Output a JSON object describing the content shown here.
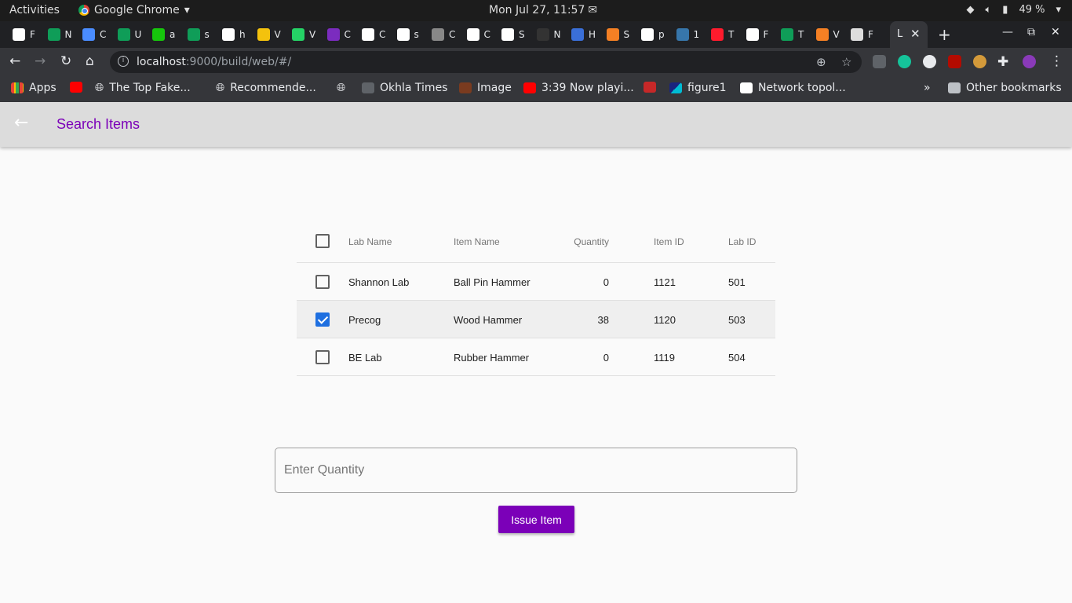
{
  "system_bar": {
    "activities": "Activities",
    "app_name": "Google Chrome",
    "clock": "Mon Jul 27, 11:57",
    "battery": "49 %"
  },
  "browser": {
    "active_tab_title": "L",
    "url_host": "localhost",
    "url_path": ":9000/build/web/#/",
    "tabs": [
      {
        "letter": "F",
        "icon": "gmail-icon",
        "color": "#ffffff"
      },
      {
        "letter": "N",
        "icon": "google-drive-icon",
        "color": "#0f9d58"
      },
      {
        "letter": "C",
        "icon": "infinity-icon",
        "color": "#4a8cff"
      },
      {
        "letter": "U",
        "icon": "sheets-icon",
        "color": "#0f9d58"
      },
      {
        "letter": "a",
        "icon": "fa-icon",
        "color": "#16c60c"
      },
      {
        "letter": "s",
        "icon": "sheets-icon",
        "color": "#0f9d58"
      },
      {
        "letter": "h",
        "icon": "google-icon",
        "color": "#ffffff"
      },
      {
        "letter": "V",
        "icon": "k-icon",
        "color": "#f4c20d"
      },
      {
        "letter": "V",
        "icon": "whatsapp-icon",
        "color": "#25d366"
      },
      {
        "letter": "C",
        "icon": "list-icon",
        "color": "#7b2cbf"
      },
      {
        "letter": "C",
        "icon": "globe-icon",
        "color": "#ffffff"
      },
      {
        "letter": "s",
        "icon": "google-icon",
        "color": "#ffffff"
      },
      {
        "letter": "C",
        "icon": "barcode-icon",
        "color": "#888888"
      },
      {
        "letter": "C",
        "icon": "image-icon",
        "color": "#ffffff"
      },
      {
        "letter": "S",
        "icon": "google-icon",
        "color": "#ffffff"
      },
      {
        "letter": "N",
        "icon": "github-icon",
        "color": "#333333"
      },
      {
        "letter": "H",
        "icon": "info-icon",
        "color": "#3a6fd8"
      },
      {
        "letter": "S",
        "icon": "stackoverflow-icon",
        "color": "#f48024"
      },
      {
        "letter": "p",
        "icon": "google-icon",
        "color": "#ffffff"
      },
      {
        "letter": "1",
        "icon": "python-icon",
        "color": "#3776ab"
      },
      {
        "letter": "T",
        "icon": "opera-icon",
        "color": "#ff1b2d"
      },
      {
        "letter": "F",
        "icon": "network-icon",
        "color": "#ffffff"
      },
      {
        "letter": "T",
        "icon": "green-square-icon",
        "color": "#0f9d58"
      },
      {
        "letter": "V",
        "icon": "stackoverflow-icon",
        "color": "#f48024"
      },
      {
        "letter": "F",
        "icon": "page-thumb-icon",
        "color": "#dddddd"
      }
    ]
  },
  "bookmarks": [
    {
      "label": "Apps",
      "icon": "apps-grid-icon"
    },
    {
      "label": "",
      "icon": "youtube-icon"
    },
    {
      "label": "The Top Fake...",
      "icon": "globe-icon"
    },
    {
      "label": "Recommende...",
      "icon": "globe-icon"
    },
    {
      "label": "",
      "icon": "globe-icon"
    },
    {
      "label": "Okhla Times",
      "icon": "okhla-icon"
    },
    {
      "label": "Image",
      "icon": "image-icon"
    },
    {
      "label": "3:39 Now playi...",
      "icon": "youtube-icon"
    },
    {
      "label": "",
      "icon": "bookmark-red-icon"
    },
    {
      "label": "figure1",
      "icon": "figure-icon"
    },
    {
      "label": "Network topol...",
      "icon": "wikipedia-icon"
    }
  ],
  "bookmarks_overflow": "»",
  "other_bookmarks": "Other bookmarks",
  "app": {
    "title": "Search Items",
    "accent_color": "#7b00b8",
    "table": {
      "columns": [
        "Lab Name",
        "Item Name",
        "Quantity",
        "Item ID",
        "Lab ID"
      ],
      "rows": [
        {
          "lab_name": "Shannon Lab",
          "item_name": "Ball Pin Hammer",
          "quantity": "0",
          "item_id": "1121",
          "lab_id": "501",
          "selected": false
        },
        {
          "lab_name": "Precog",
          "item_name": "Wood Hammer",
          "quantity": "38",
          "item_id": "1120",
          "lab_id": "503",
          "selected": true
        },
        {
          "lab_name": "BE Lab",
          "item_name": "Rubber Hammer",
          "quantity": "0",
          "item_id": "1119",
          "lab_id": "504",
          "selected": false
        }
      ]
    },
    "quantity_input": {
      "placeholder": "Enter Quantity",
      "value": ""
    },
    "issue_button": "Issue Item"
  }
}
